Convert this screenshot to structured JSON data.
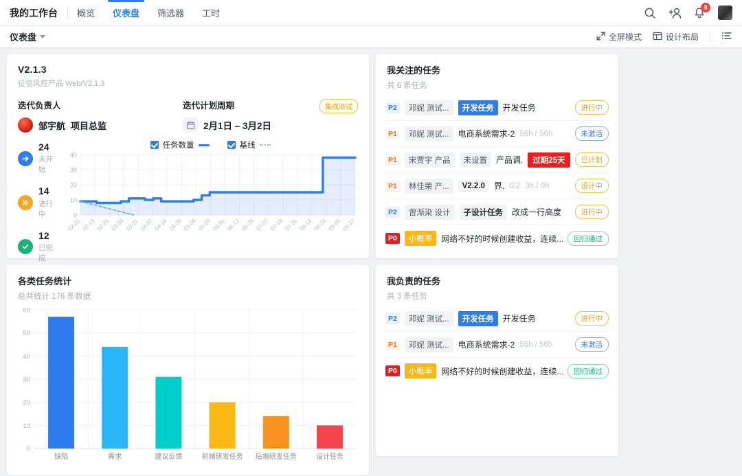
{
  "nav": {
    "brand": "我的工作台",
    "tabs": [
      {
        "label": "概览",
        "active": false
      },
      {
        "label": "仪表盘",
        "active": true
      },
      {
        "label": "筛选器",
        "active": false
      },
      {
        "label": "工时",
        "active": false
      }
    ],
    "icons": {
      "search": "search-icon",
      "add_user": "add-user-icon",
      "bell": "bell-icon"
    },
    "notification_count": "8"
  },
  "subbar": {
    "title": "仪表盘",
    "fullscreen": "全屏模式",
    "design_layout": "设计布局",
    "list_icon": "list-view-icon"
  },
  "iteration": {
    "version": "V2.1.3",
    "path": "征信风控产品 Web/V2.1.3",
    "owner_label": "迭代负责人",
    "owner_name": "邹宇航",
    "owner_role": "项目总监",
    "cycle_label": "迭代计划周期",
    "cycle_value": "2月1日 – 3月2日",
    "stage_tag": "集成测试",
    "counters": [
      {
        "count": "24",
        "label": "未开始",
        "color": "#2f7ded",
        "icon": "arrow-right-icon"
      },
      {
        "count": "14",
        "label": "进行中",
        "color": "#f5a623",
        "icon": "double-arrow-right-icon"
      },
      {
        "count": "12",
        "label": "已完成",
        "color": "#19b37a",
        "icon": "check-icon"
      }
    ]
  },
  "chart_data": [
    {
      "type": "line",
      "title": "",
      "legend": [
        {
          "name": "任务数量",
          "style": "solid",
          "color": "#2f7ded",
          "checked": true
        },
        {
          "name": "基线",
          "style": "dotted",
          "color": "#8ab6f0",
          "checked": true
        }
      ],
      "legend_position": "top-center",
      "grid": true,
      "xlabel": "",
      "ylabel": "",
      "ylim": [
        0,
        40
      ],
      "yticks": [
        0,
        10,
        20,
        30,
        40
      ],
      "x": [
        "02-01",
        "02-13",
        "02-25",
        "03-09",
        "03-21",
        "04-02",
        "04-14",
        "04-26",
        "05-08",
        "05-20",
        "06-01",
        "06-13",
        "06-25",
        "07-07",
        "07-19",
        "07-31",
        "08-12",
        "08-24",
        "09-05",
        "09-17"
      ],
      "series": [
        {
          "name": "任务数量",
          "values": [
            9,
            9,
            8,
            8,
            8,
            9,
            11,
            11,
            10,
            11,
            9,
            9,
            9,
            9,
            10,
            13,
            15,
            15,
            15,
            15,
            15,
            15,
            15,
            15,
            15,
            15,
            15,
            15,
            15,
            15,
            38,
            38,
            38,
            38,
            38
          ]
        },
        {
          "name": "基线",
          "values": [
            9,
            6,
            3,
            0
          ]
        }
      ]
    },
    {
      "type": "bar",
      "title": "各类任务统计",
      "subtitle": "总共统计 176 条数据",
      "categories": [
        "缺陷",
        "需求",
        "建议反馈",
        "前端研发任务",
        "后端研发任务",
        "设计任务"
      ],
      "values": [
        57,
        44,
        31,
        20,
        14,
        10
      ],
      "colors": [
        "#2f7ded",
        "#29b6f6",
        "#00cfc8",
        "#f9b815",
        "#f7921e",
        "#f5444c"
      ],
      "xlabel": "",
      "ylabel": "",
      "ylim": [
        0,
        60
      ],
      "yticks": [
        0,
        10,
        20,
        30,
        40,
        50,
        60
      ],
      "grid": true
    }
  ],
  "bar_card": {
    "title": "各类任务统计",
    "subtitle": "总共统计 176 条数据"
  },
  "watched": {
    "title": "我关注的任务",
    "subtitle": "共 6 条任务",
    "rows": [
      {
        "priority": "P2",
        "priority_class": "p2",
        "assignee": "邓妮 测试...",
        "chips": [
          {
            "text": "开发任务",
            "type": "blue"
          }
        ],
        "text": "开发任务",
        "muted": "",
        "muted2": "",
        "status": "进行中",
        "status_class": "st-doing"
      },
      {
        "priority": "P1",
        "priority_class": "p1",
        "assignee": "邓妮 测试...",
        "chips": [],
        "text": "电商系统需求-2",
        "muted": "56h / 56h",
        "muted2": "",
        "status": "未激活",
        "status_class": "st-inactive"
      },
      {
        "priority": "P1",
        "priority_class": "p1",
        "assignee": "宋贾宇 产品",
        "chips": [
          {
            "text": "未设置",
            "type": "grey"
          }
        ],
        "text": "产品调...",
        "muted": "",
        "muted2": "",
        "badge": "过期25天",
        "status": "已计划",
        "status_class": "st-planned"
      },
      {
        "priority": "P1",
        "priority_class": "p1",
        "assignee": "林佳荣 产...",
        "chips": [
          {
            "text": "V2.2.0",
            "type": "strong"
          }
        ],
        "text": "界.",
        "muted": "0/2",
        "muted2": "3h / 0h",
        "status": "设计中",
        "status_class": "st-design"
      },
      {
        "priority": "P2",
        "priority_class": "p2",
        "assignee": "曾渐染 设计",
        "chips": [
          {
            "text": "子设计任务",
            "type": "strong"
          }
        ],
        "text": "改成一行高度",
        "muted": "",
        "muted2": "",
        "status": "进行中",
        "status_class": "st-doing"
      },
      {
        "priority": "P0",
        "priority_class": "p0",
        "assignee": "",
        "chips": [
          {
            "text": "小概率",
            "type": "yellow"
          }
        ],
        "text": "网络不好的时候创建收益，连续...",
        "muted": "",
        "muted2": "",
        "status": "回归通过",
        "status_class": "st-pass"
      }
    ]
  },
  "owned": {
    "title": "我负责的任务",
    "subtitle": "共 3 条任务",
    "rows": [
      {
        "priority": "P2",
        "priority_class": "p2",
        "assignee": "邓妮 测试...",
        "chips": [
          {
            "text": "开发任务",
            "type": "blue"
          }
        ],
        "text": "开发任务",
        "muted": "",
        "status": "进行中",
        "status_class": "st-doing"
      },
      {
        "priority": "P1",
        "priority_class": "p1",
        "assignee": "邓妮 测试...",
        "chips": [],
        "text": "电商系统需求-2",
        "muted": "56h / 56h",
        "status": "未激活",
        "status_class": "st-inactive"
      },
      {
        "priority": "P0",
        "priority_class": "p0",
        "assignee": "",
        "chips": [
          {
            "text": "小概率",
            "type": "yellow"
          }
        ],
        "text": "网络不好的时候创建收益，连续...",
        "muted": "",
        "status": "回归通过",
        "status_class": "st-pass"
      }
    ]
  }
}
